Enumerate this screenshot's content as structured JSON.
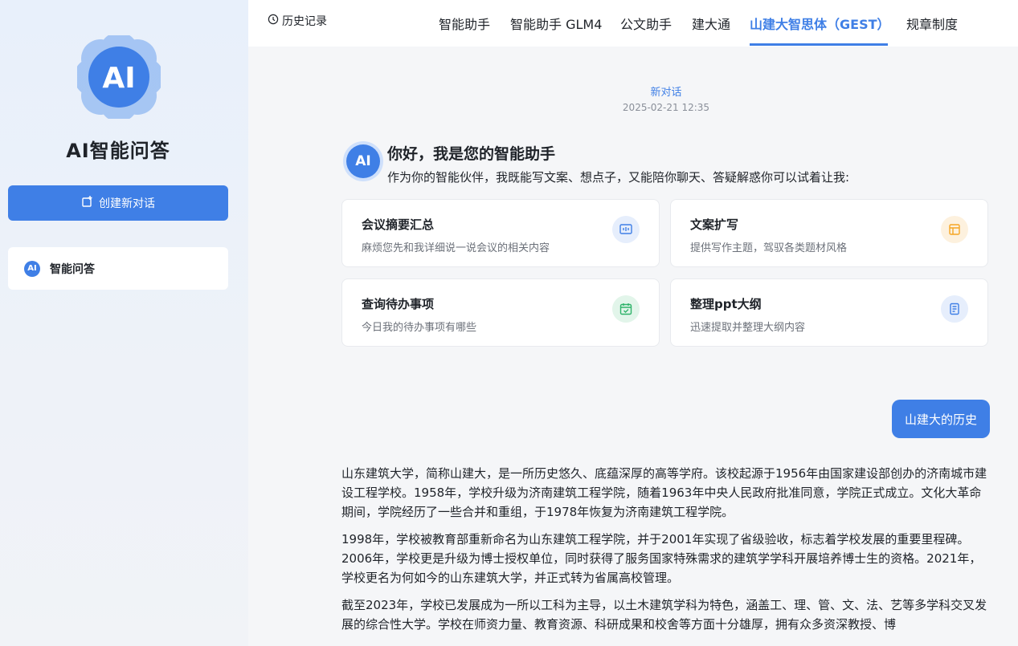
{
  "sidebar": {
    "logo_text": "AI",
    "app_title": "AI智能问答",
    "new_chat_label": "创建新对话",
    "items": [
      {
        "icon_text": "AI",
        "label": "智能问答"
      }
    ]
  },
  "header": {
    "history_label": "历史记录",
    "tabs": [
      {
        "label": "智能助手"
      },
      {
        "label": "智能助手 GLM4"
      },
      {
        "label": "公文助手"
      },
      {
        "label": "建大通"
      },
      {
        "label": "山建大智思体（GEST）",
        "active": true
      },
      {
        "label": "规章制度"
      }
    ]
  },
  "conversation": {
    "title": "新对话",
    "time": "2025-02-21 12:35"
  },
  "greeting": {
    "icon_text": "AI",
    "title": "你好，我是您的智能助手",
    "subtitle": "作为你的智能伙伴，我既能写文案、想点子，又能陪你聊天、答疑解惑你可以试着让我:"
  },
  "cards": [
    {
      "title": "会议摘要汇总",
      "desc": "麻烦您先和我详细说一说会议的相关内容",
      "icon": "meeting-icon",
      "color": "#3f7fe6"
    },
    {
      "title": "文案扩写",
      "desc": "提供写作主题，驾驭各类题材风格",
      "icon": "document-icon",
      "color": "#f5a623"
    },
    {
      "title": "查询待办事项",
      "desc": "今日我的待办事项有哪些",
      "icon": "calendar-check-icon",
      "color": "#2fb36a"
    },
    {
      "title": "整理ppt大纲",
      "desc": "迅速提取并整理大纲内容",
      "icon": "outline-icon",
      "color": "#3f7fe6"
    }
  ],
  "messages": {
    "user": "山建大的历史",
    "answer": [
      "山东建筑大学，简称山建大，是一所历史悠久、底蕴深厚的高等学府。该校起源于1956年由国家建设部创办的济南城市建设工程学校。1958年，学校升级为济南建筑工程学院，随着1963年中央人民政府批准同意，学院正式成立。文化大革命期间，学院经历了一些合并和重组，于1978年恢复为济南建筑工程学院。",
      "1998年，学校被教育部重新命名为山东建筑工程学院，并于2001年实现了省级验收，标志着学校发展的重要里程碑。2006年，学校更是升级为博士授权单位，同时获得了服务国家特殊需求的建筑学学科开展培养博士生的资格。2021年，学校更名为何如今的山东建筑大学，并正式转为省属高校管理。",
      "截至2023年，学校已发展成为一所以工科为主导，以土木建筑学科为特色，涵盖工、理、管、文、法、艺等多学科交叉发展的综合性大学。学校在师资力量、教育资源、科研成果和校舍等方面十分雄厚，拥有众多资深教授、博"
    ]
  }
}
